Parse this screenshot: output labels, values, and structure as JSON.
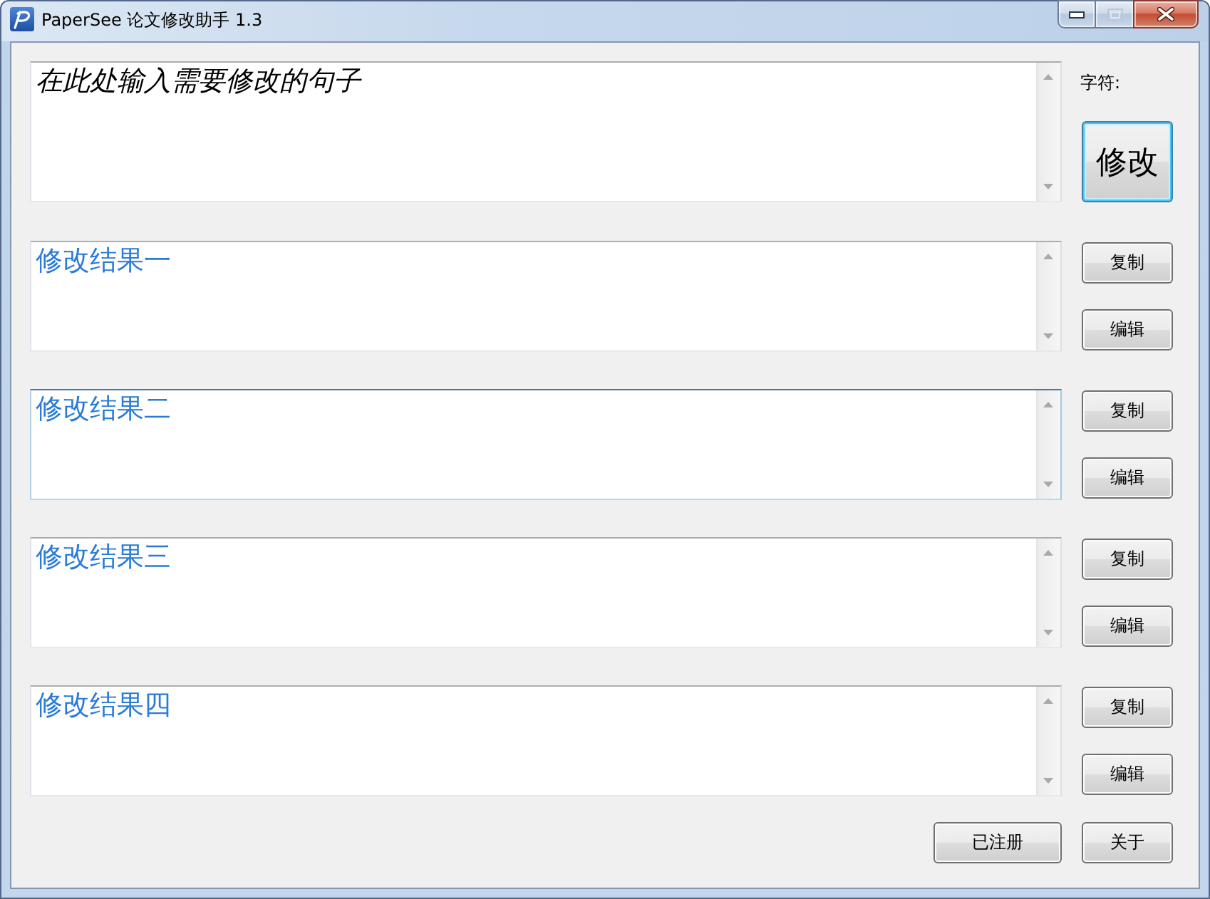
{
  "window": {
    "title": "PaperSee 论文修改助手 1.3",
    "maximize_disabled": true
  },
  "input": {
    "placeholder": "在此处输入需要修改的句子"
  },
  "char_count": {
    "label": "字符:"
  },
  "revise_button": {
    "label": "修改",
    "focused": true
  },
  "results": [
    {
      "value": "修改结果一",
      "hovered": false,
      "buttons": [
        "复制",
        "编辑"
      ]
    },
    {
      "value": "修改结果二",
      "hovered": true,
      "buttons": [
        "复制",
        "编辑"
      ]
    },
    {
      "value": "修改结果三",
      "hovered": false,
      "buttons": [
        "复制",
        "编辑"
      ]
    },
    {
      "value": "修改结果四",
      "hovered": false,
      "buttons": [
        "复制",
        "编辑"
      ]
    }
  ],
  "footer_buttons": [
    "已注册",
    "关于"
  ]
}
